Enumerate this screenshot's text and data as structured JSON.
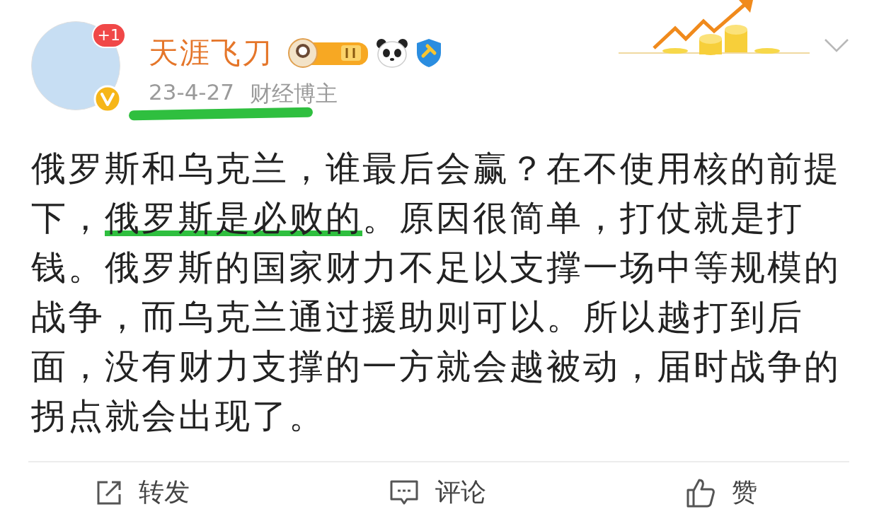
{
  "post": {
    "author": {
      "name": "天涯飞刀",
      "notification_badge": "+1",
      "verified": true
    },
    "meta": {
      "date": "23-4-27",
      "tag": "财经博主",
      "underlined": true
    },
    "body": [
      {
        "text": "俄罗斯和乌克兰，谁最后会赢？在不使用核的前提下，",
        "highlighted": false
      },
      {
        "text": "俄罗斯是必败的",
        "highlighted": true
      },
      {
        "text": "。原因很简单，打仗就是打钱。俄罗斯的国家财力不足以支撑一场中等规模的战争，而乌克兰通过援助则可以。所以越打到后面，没有财力支撑的一方就会越被动，届时战争的拐点就会出现了。",
        "highlighted": false
      }
    ],
    "actions": [
      {
        "kind": "repost",
        "label": "转发"
      },
      {
        "kind": "comment",
        "label": "评论"
      },
      {
        "kind": "like",
        "label": "赞"
      }
    ]
  }
}
